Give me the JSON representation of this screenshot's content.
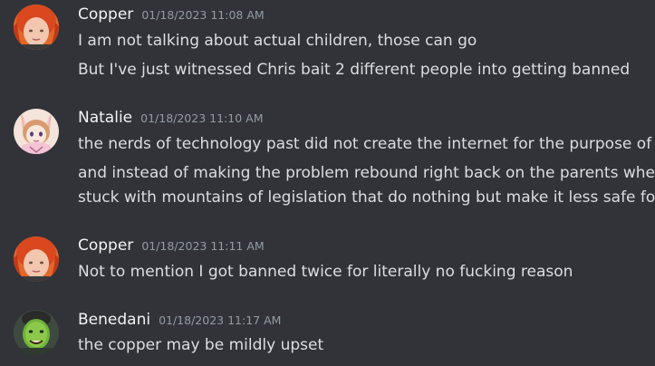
{
  "messages": [
    {
      "author": "Copper",
      "avatar": "red-hair-avatar",
      "timestamp": "01/18/2023 11:08 AM",
      "lines": [
        "I am not talking about actual children, those can go",
        "But I've just witnessed Chris bait 2 different people into getting banned"
      ]
    },
    {
      "author": "Natalie",
      "avatar": "anime-fox-avatar",
      "timestamp": "01/18/2023 11:10 AM",
      "lines": [
        "the nerds of technology past did not create the internet for the purpose of a",
        "and instead of making the problem rebound right back on the parents when",
        "stuck with mountains of legislation that do nothing but make it less safe for"
      ]
    },
    {
      "author": "Copper",
      "avatar": "red-hair-avatar",
      "timestamp": "01/18/2023 11:11 AM",
      "lines": [
        "Not to mention I got banned twice for literally no fucking reason"
      ]
    },
    {
      "author": "Benedani",
      "avatar": "green-face-avatar",
      "timestamp": "01/18/2023 11:17 AM",
      "lines": [
        "the copper may be mildly upset"
      ]
    }
  ],
  "colors": {
    "background": "#313338",
    "username": "#f2f3f5",
    "text": "#dbdee1",
    "timestamp": "#949ba4"
  }
}
